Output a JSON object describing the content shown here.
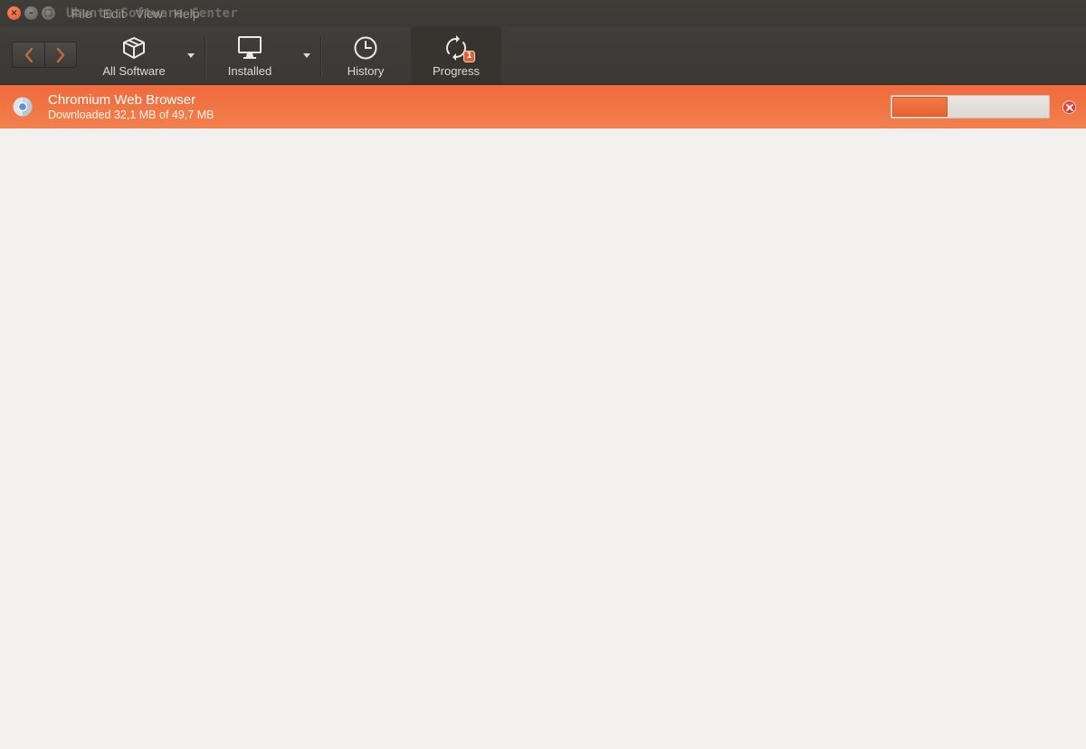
{
  "window": {
    "title": "Ubuntu Software Center",
    "menu": [
      "File",
      "Edit",
      "View",
      "Help"
    ]
  },
  "toolbar": {
    "items": [
      {
        "label": "All Software",
        "icon": "software-box-icon"
      },
      {
        "label": "Installed",
        "icon": "monitor-icon"
      },
      {
        "label": "History",
        "icon": "clock-icon"
      },
      {
        "label": "Progress",
        "icon": "sync-arrows-icon",
        "badge": "1",
        "active": true
      }
    ]
  },
  "progress": {
    "items": [
      {
        "name": "Chromium Web Browser",
        "status": "Downloaded 32,1 MB of 49,7 MB",
        "fraction": 0.36,
        "icon": "chromium-icon"
      }
    ]
  },
  "colors": {
    "accent": "#ef6a3c",
    "toolbar": "#3c3b37",
    "background": "#f2f1f0"
  }
}
